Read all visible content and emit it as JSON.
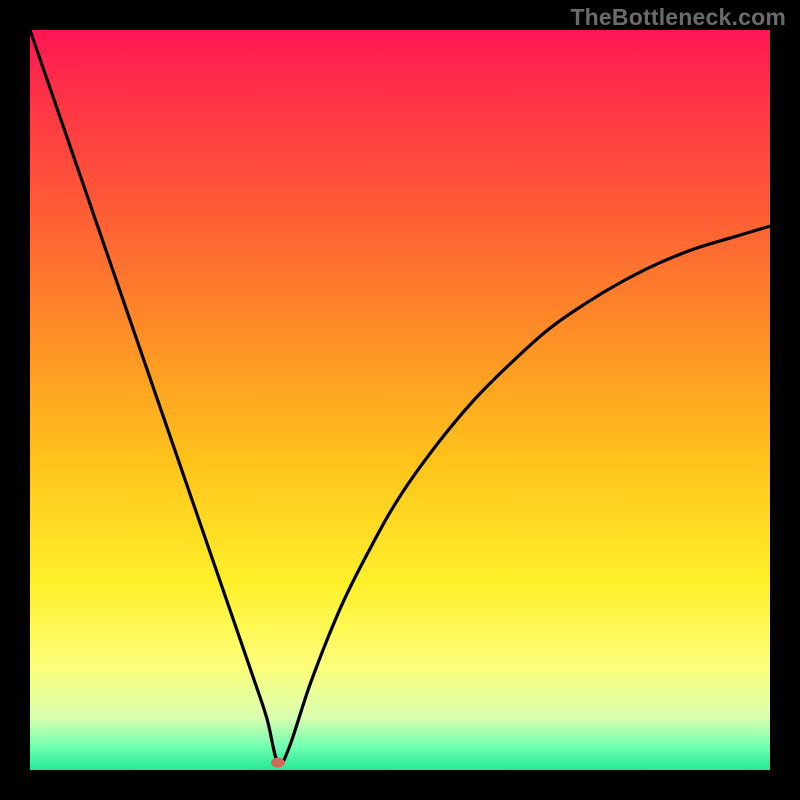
{
  "watermark": "TheBottleneck.com",
  "chart_data": {
    "type": "line",
    "title": "",
    "xlabel": "",
    "ylabel": "",
    "xlim": [
      0,
      100
    ],
    "ylim": [
      0,
      100
    ],
    "grid": false,
    "legend": false,
    "series": [
      {
        "name": "bottleneck-curve",
        "x": [
          0,
          5,
          10,
          15,
          20,
          25,
          30,
          32,
          33.5,
          35,
          38,
          42,
          46,
          50,
          55,
          60,
          65,
          70,
          75,
          80,
          85,
          90,
          95,
          100
        ],
        "y": [
          100,
          85.5,
          71,
          56.5,
          42,
          27.5,
          13,
          7,
          1,
          3,
          12,
          22,
          30,
          37,
          44,
          50,
          55,
          59.5,
          63,
          66,
          68.5,
          70.5,
          72,
          73.5
        ]
      }
    ],
    "marker": {
      "x": 33.5,
      "y": 1
    },
    "gradient_stops": [
      {
        "pos": 0,
        "color": "#ff1453"
      },
      {
        "pos": 6,
        "color": "#ff2a4a"
      },
      {
        "pos": 22,
        "color": "#ff5538"
      },
      {
        "pos": 40,
        "color": "#ff8b27"
      },
      {
        "pos": 58,
        "color": "#ffc21a"
      },
      {
        "pos": 75,
        "color": "#fff12b"
      },
      {
        "pos": 86,
        "color": "#fdff7a"
      },
      {
        "pos": 93,
        "color": "#d8ffb0"
      },
      {
        "pos": 97,
        "color": "#6cffb0"
      },
      {
        "pos": 100,
        "color": "#23e995"
      }
    ]
  }
}
